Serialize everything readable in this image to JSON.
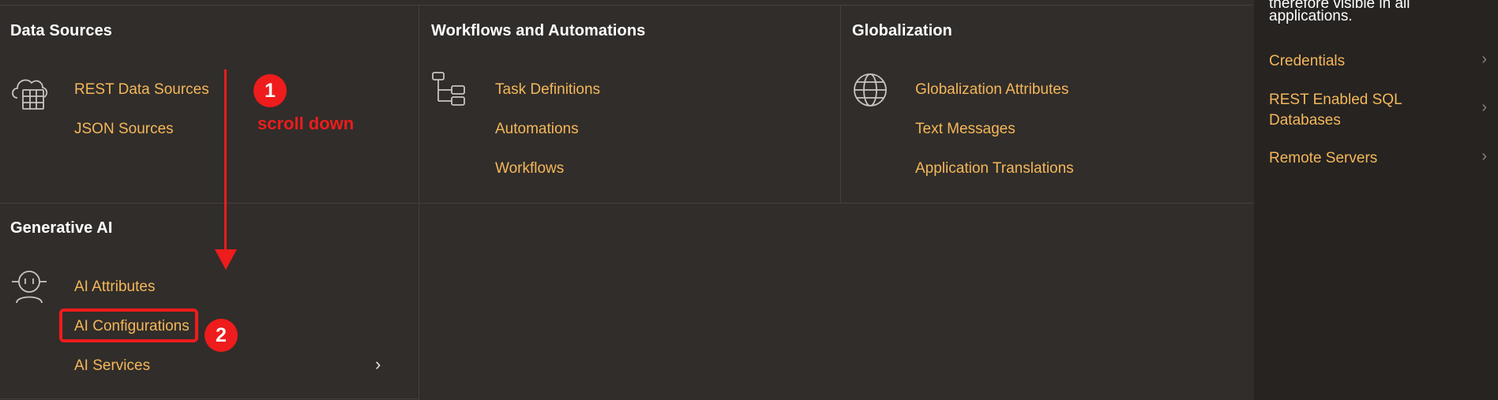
{
  "sections": {
    "data_sources": {
      "title": "Data Sources",
      "links": [
        "REST Data Sources",
        "JSON Sources"
      ]
    },
    "workflows": {
      "title": "Workflows and Automations",
      "links": [
        "Task Definitions",
        "Automations",
        "Workflows"
      ]
    },
    "globalization": {
      "title": "Globalization",
      "links": [
        "Globalization Attributes",
        "Text Messages",
        "Application Translations"
      ]
    },
    "generative_ai": {
      "title": "Generative AI",
      "links": [
        "AI Attributes",
        "AI Configurations",
        "AI Services"
      ]
    }
  },
  "sidebar": {
    "note_lines": [
      "therefore visible in all",
      "applications."
    ],
    "items": [
      {
        "label_line1": "Credentials",
        "label_line2": ""
      },
      {
        "label_line1": "REST Enabled SQL",
        "label_line2": "Databases"
      },
      {
        "label_line1": "Remote Servers",
        "label_line2": ""
      }
    ]
  },
  "annotations": {
    "step1_number": "1",
    "step1_text": "scroll down",
    "step2_number": "2",
    "color": "#ee1c1c"
  },
  "icons": {
    "data_sources": "cloud-table-icon",
    "workflows": "hierarchy-tree-icon",
    "globalization": "globe-icon",
    "generative_ai": "robot-face-icon",
    "chevron": "chevron-right-icon"
  },
  "colors": {
    "background": "#312d2a",
    "sidebar": "#262321",
    "link": "#f4b75a",
    "title": "#ffffff"
  }
}
